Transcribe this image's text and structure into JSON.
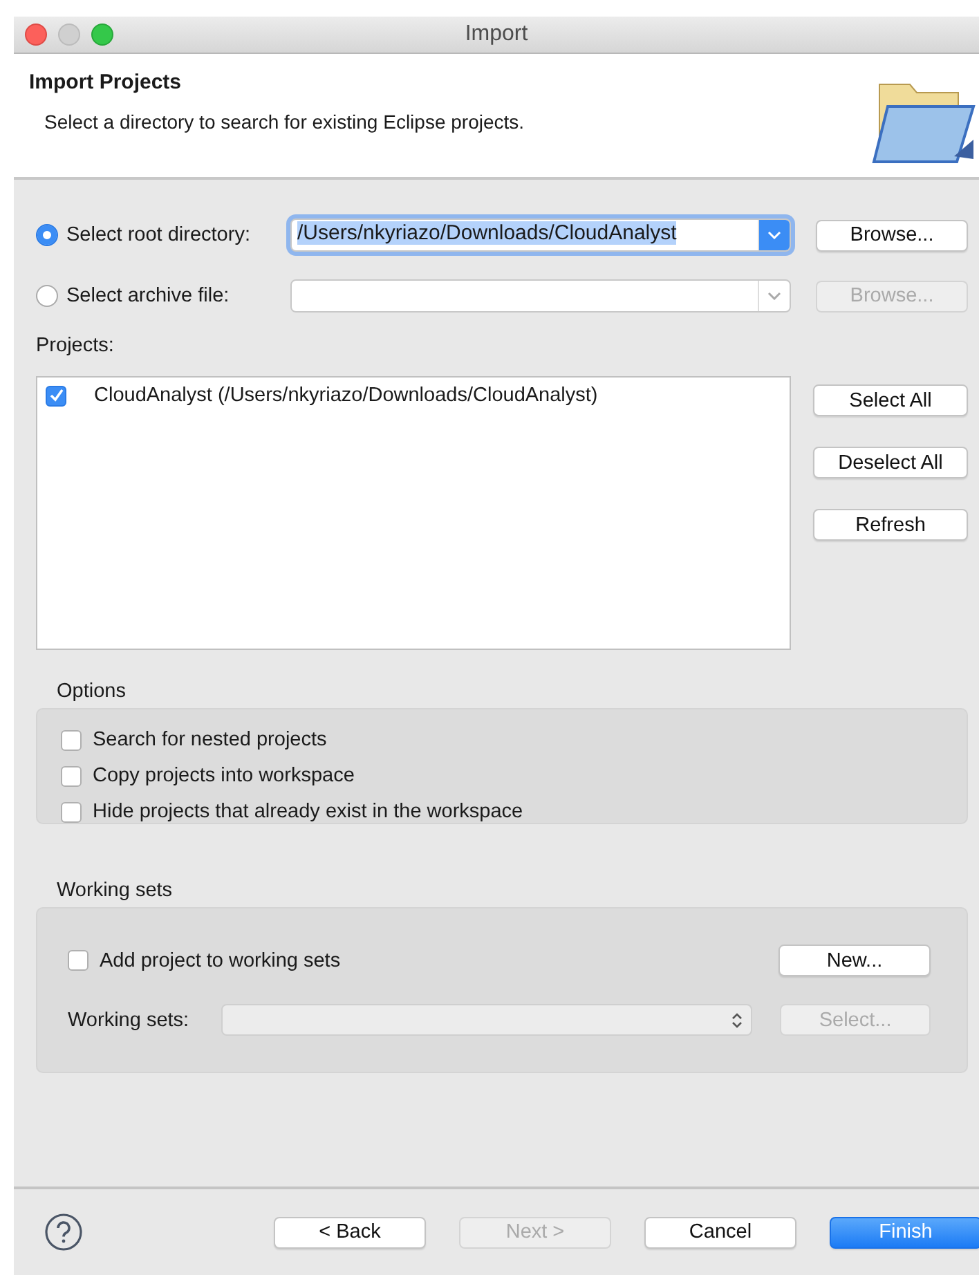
{
  "window": {
    "title": "Import"
  },
  "header": {
    "title": "Import Projects",
    "description": "Select a directory to search for existing Eclipse projects."
  },
  "sources": [
    {
      "label": "Select root directory:",
      "selected": true,
      "value": "/Users/nkyriazo/Downloads/CloudAnalyst",
      "value_highlighted": true,
      "disabled": false,
      "browse": {
        "label": "Browse...",
        "disabled": false
      }
    },
    {
      "label": "Select archive file:",
      "selected": false,
      "disabled": true,
      "browse": {
        "label": "Browse...",
        "disabled": true
      }
    }
  ],
  "projects": {
    "label": "Projects:",
    "items": [
      {
        "label": "CloudAnalyst (/Users/nkyriazo/Downloads/CloudAnalyst)",
        "checked": true
      }
    ],
    "buttons": [
      {
        "label": "Select All",
        "disabled": false
      },
      {
        "label": "Deselect All",
        "disabled": false
      },
      {
        "label": "Refresh",
        "disabled": false
      }
    ]
  },
  "options": {
    "title": "Options",
    "items": [
      {
        "label": "Search for nested projects",
        "checked": false
      },
      {
        "label": "Copy projects into workspace",
        "checked": false
      },
      {
        "label": "Hide projects that already exist in the workspace",
        "checked": false
      }
    ]
  },
  "working_sets": {
    "title": "Working sets",
    "checkbox": {
      "label": "Add project to working sets",
      "checked": false
    },
    "new_button": {
      "label": "New...",
      "disabled": false
    },
    "field_label": "Working sets:",
    "field_disabled": true,
    "select_button": {
      "label": "Select...",
      "disabled": true
    }
  },
  "footer": {
    "buttons": [
      {
        "label": "< Back",
        "disabled": false,
        "default": false
      },
      {
        "label": "Next >",
        "disabled": true,
        "default": false
      },
      {
        "label": "Cancel",
        "disabled": false,
        "default": false
      },
      {
        "label": "Finish",
        "disabled": false,
        "default": true
      }
    ]
  }
}
